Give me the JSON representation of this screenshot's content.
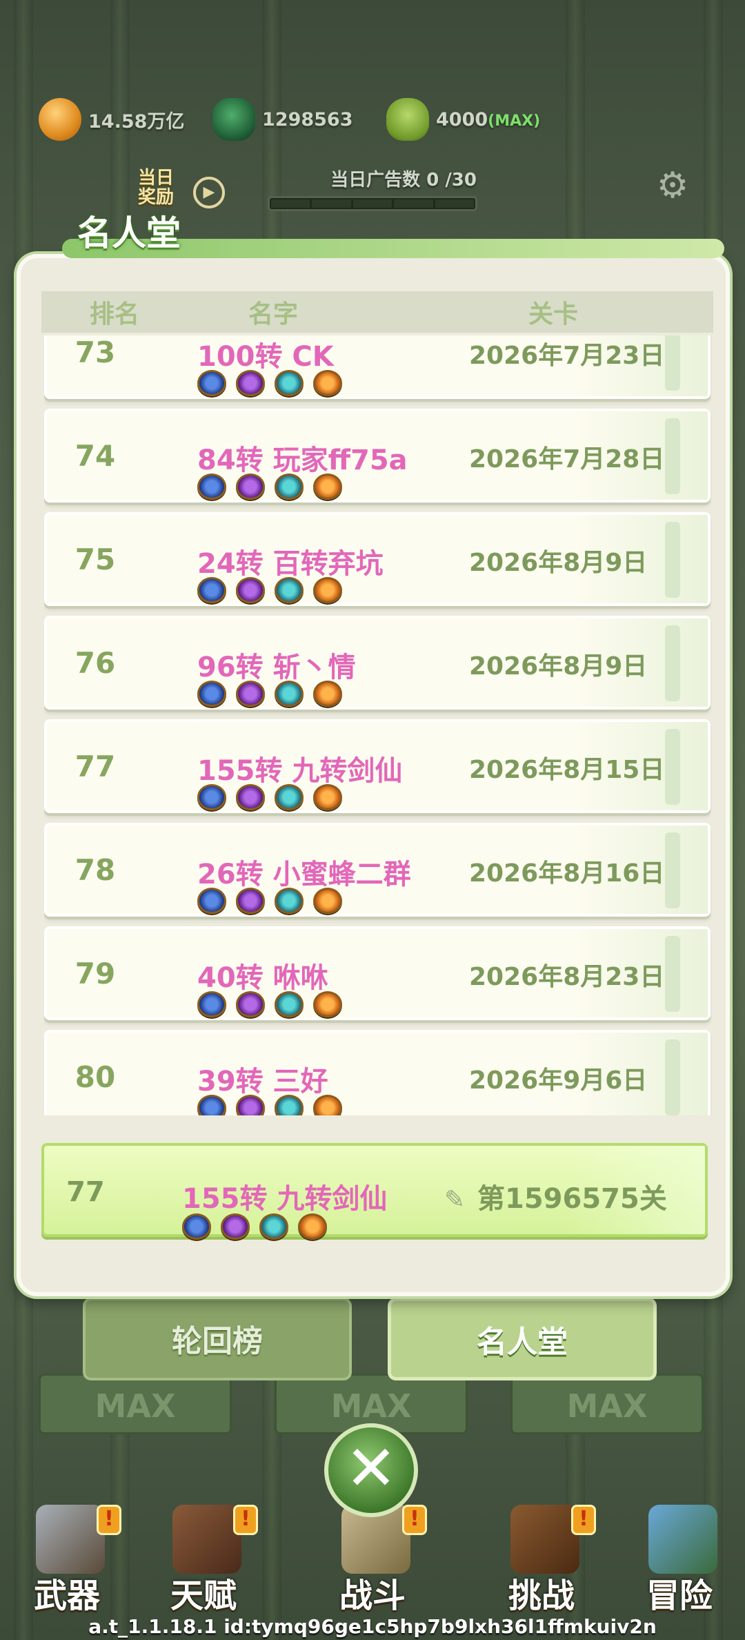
{
  "resources": {
    "coins": "14.58万亿",
    "eggs": "1298563",
    "leaves": "4000",
    "leaves_max": "(MAX)"
  },
  "ad": {
    "label": "当日广告数 0 /30"
  },
  "daily_btn": {
    "label": "当日\n奖励"
  },
  "modal": {
    "title": "名人堂",
    "headers": {
      "rank": "排名",
      "name": "名字",
      "level": "关卡"
    },
    "rows": [
      {
        "rank": "73",
        "name": "100转 CK",
        "date": "2026年7月23日"
      },
      {
        "rank": "74",
        "name": "84转 玩家ff75a",
        "date": "2026年7月28日"
      },
      {
        "rank": "75",
        "name": "24转 百转弃坑",
        "date": "2026年8月9日"
      },
      {
        "rank": "76",
        "name": "96转 斩丶情",
        "date": "2026年8月9日"
      },
      {
        "rank": "77",
        "name": "155转 九转剑仙",
        "date": "2026年8月15日"
      },
      {
        "rank": "78",
        "name": "26转 小蜜蜂二群",
        "date": "2026年8月16日"
      },
      {
        "rank": "79",
        "name": "40转 咻咻",
        "date": "2026年8月23日"
      },
      {
        "rank": "80",
        "name": "39转 三好",
        "date": "2026年9月6日"
      }
    ],
    "me": {
      "rank": "77",
      "name": "155转 九转剑仙",
      "level": "第1596575关"
    }
  },
  "tabs": {
    "reincarnation": "轮回榜",
    "hall_of_fame": "名人堂"
  },
  "max_labels": [
    "MAX",
    "MAX",
    "MAX"
  ],
  "close_icon": "close-x",
  "nav": [
    {
      "label": "武器",
      "badge": "!"
    },
    {
      "label": "天赋",
      "badge": "!"
    },
    {
      "label": "战斗",
      "badge": "!"
    },
    {
      "label": "挑战",
      "badge": "!"
    },
    {
      "label": "冒险",
      "badge": ""
    }
  ],
  "footer": "a.t_1.1.18.1 id:tymq96ge1c5hp7b9lxh36l1ffmkuiv2n",
  "colors": {
    "name_pink": "#e267b9",
    "rank_green": "#86a660",
    "date_green": "#7d9a5c",
    "my_row_bg": "#e2f6b0"
  }
}
